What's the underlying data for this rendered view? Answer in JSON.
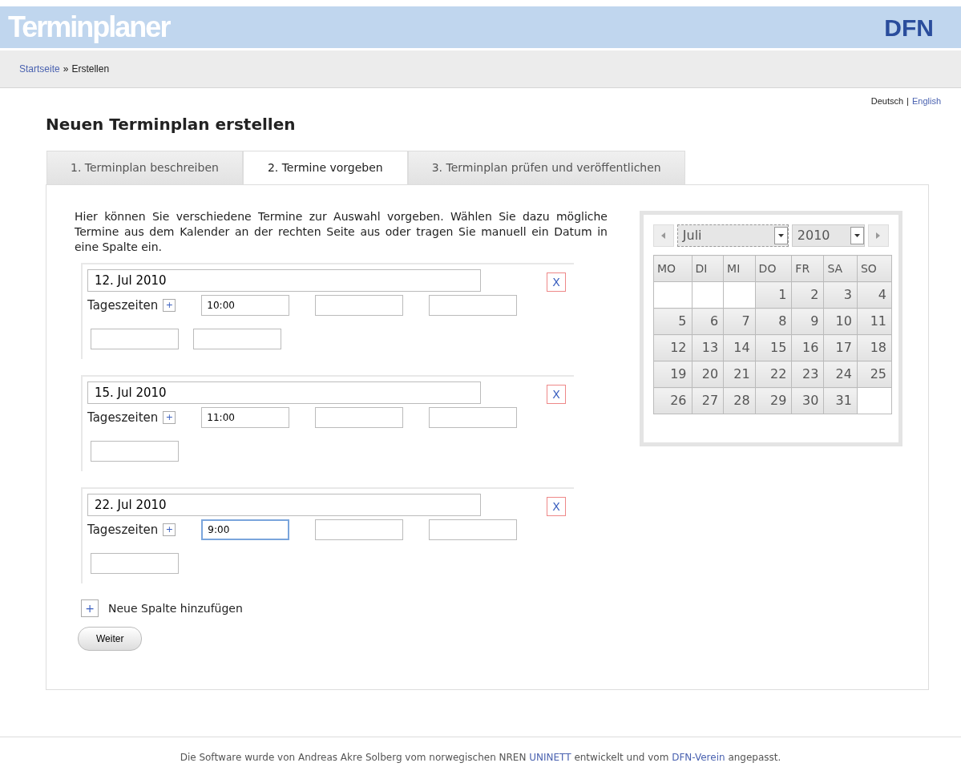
{
  "header": {
    "title": "Terminplaner",
    "logo": "DFN"
  },
  "breadcrumb": {
    "link": "Startseite",
    "separator": "»",
    "current": "Erstellen"
  },
  "languages": [
    {
      "label": "Deutsch",
      "selected": true
    },
    {
      "label": "English",
      "selected": false
    }
  ],
  "language_separator": "|",
  "heading": "Neuen Terminplan erstellen",
  "tabs": [
    {
      "label": "1. Terminplan beschreiben",
      "selected": false
    },
    {
      "label": "2. Termine vorgeben",
      "selected": true
    },
    {
      "label": "3. Terminplan prüfen und veröffentlichen",
      "selected": false
    }
  ],
  "intro": "Hier können Sie verschiedene Termine zur Auswahl vorgeben. Wählen Sie dazu mögliche Termine aus dem Kalender an der rechten Seite aus oder tragen Sie manuell ein Datum in eine Spalte ein.",
  "date_columns": [
    {
      "date": "12. Jul 2010",
      "times_label": "Tageszeiten",
      "add_time": "+",
      "remove": "X",
      "slots": [
        {
          "value": "10:00",
          "focused": false
        },
        {
          "focused": false
        },
        {
          "focused": false
        },
        {
          "focused": false
        },
        {
          "focused": false
        }
      ]
    },
    {
      "date": "15. Jul 2010",
      "times_label": "Tageszeiten",
      "add_time": "+",
      "remove": "X",
      "slots": [
        {
          "value": "11:00",
          "focused": false
        },
        {
          "focused": false
        },
        {
          "focused": false
        },
        {
          "focused": false
        }
      ]
    },
    {
      "date": "22. Jul 2010",
      "times_label": "Tageszeiten",
      "add_time": "+",
      "remove": "X",
      "slots": [
        {
          "value": "9:00",
          "focused": true
        },
        {
          "focused": false
        },
        {
          "focused": false
        },
        {
          "focused": false
        }
      ]
    }
  ],
  "add_column": {
    "icon": "+",
    "label": "Neue Spalte hinzufügen"
  },
  "next_button": "Weiter",
  "calendar": {
    "month": "Juli",
    "year": "2010",
    "weekdays": [
      "MO",
      "DI",
      "MI",
      "DO",
      "FR",
      "SA",
      "SO"
    ],
    "weeks": [
      [
        {
          "kind": "blank"
        },
        {
          "kind": "blank"
        },
        {
          "kind": "blank"
        },
        {
          "kind": "day",
          "day": "1"
        },
        {
          "kind": "day",
          "day": "2"
        },
        {
          "kind": "day",
          "day": "3"
        },
        {
          "kind": "day",
          "day": "4"
        }
      ],
      [
        {
          "kind": "day",
          "day": "5"
        },
        {
          "kind": "day",
          "day": "6"
        },
        {
          "kind": "day",
          "day": "7"
        },
        {
          "kind": "day",
          "day": "8"
        },
        {
          "kind": "day",
          "day": "9"
        },
        {
          "kind": "day",
          "day": "10"
        },
        {
          "kind": "day",
          "day": "11"
        }
      ],
      [
        {
          "kind": "day",
          "day": "12"
        },
        {
          "kind": "day",
          "day": "13"
        },
        {
          "kind": "day",
          "day": "14"
        },
        {
          "kind": "day",
          "day": "15"
        },
        {
          "kind": "day",
          "day": "16"
        },
        {
          "kind": "day",
          "day": "17"
        },
        {
          "kind": "day",
          "day": "18"
        }
      ],
      [
        {
          "kind": "day",
          "day": "19"
        },
        {
          "kind": "day",
          "day": "20"
        },
        {
          "kind": "day",
          "day": "21"
        },
        {
          "kind": "day",
          "day": "22"
        },
        {
          "kind": "day",
          "day": "23"
        },
        {
          "kind": "day",
          "day": "24"
        },
        {
          "kind": "day",
          "day": "25"
        }
      ],
      [
        {
          "kind": "day",
          "day": "26"
        },
        {
          "kind": "day",
          "day": "27"
        },
        {
          "kind": "day",
          "day": "28"
        },
        {
          "kind": "day",
          "day": "29"
        },
        {
          "kind": "day",
          "day": "30"
        },
        {
          "kind": "day",
          "day": "31"
        },
        {
          "kind": "blank"
        }
      ]
    ]
  },
  "footer": [
    {
      "kind": "text",
      "text": "Die Software wurde von Andreas Akre Solberg vom norwegischen NREN "
    },
    {
      "kind": "link",
      "text": "UNINETT"
    },
    {
      "kind": "text",
      "text": " entwickelt und vom "
    },
    {
      "kind": "link",
      "text": "DFN-Verein"
    },
    {
      "kind": "text",
      "text": " angepasst."
    }
  ]
}
